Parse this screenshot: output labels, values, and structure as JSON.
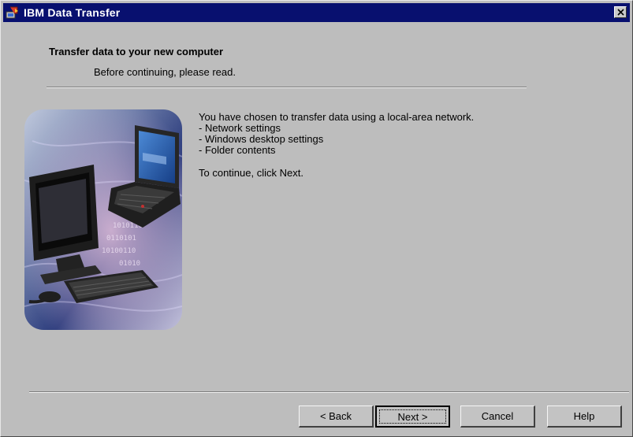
{
  "window": {
    "title": "IBM Data Transfer"
  },
  "header": {
    "title": "Transfer data to your new computer",
    "subtitle": "Before continuing, please read."
  },
  "content": {
    "intro": "You have chosen to transfer data using a local-area network.",
    "items": [
      "- Network settings",
      "- Windows desktop settings",
      "- Folder contents"
    ],
    "instruction": "To continue, click Next."
  },
  "illustration": {
    "icon_name": "computers-illustration",
    "binary_text": [
      "1010110",
      "0110101",
      "10100110",
      "01010"
    ]
  },
  "buttons": {
    "back_label": "< Back",
    "next_label": "Next >",
    "cancel_label": "Cancel",
    "help_label": "Help"
  },
  "colors": {
    "titlebar": "#08106f",
    "face": "#bdbdbd"
  }
}
